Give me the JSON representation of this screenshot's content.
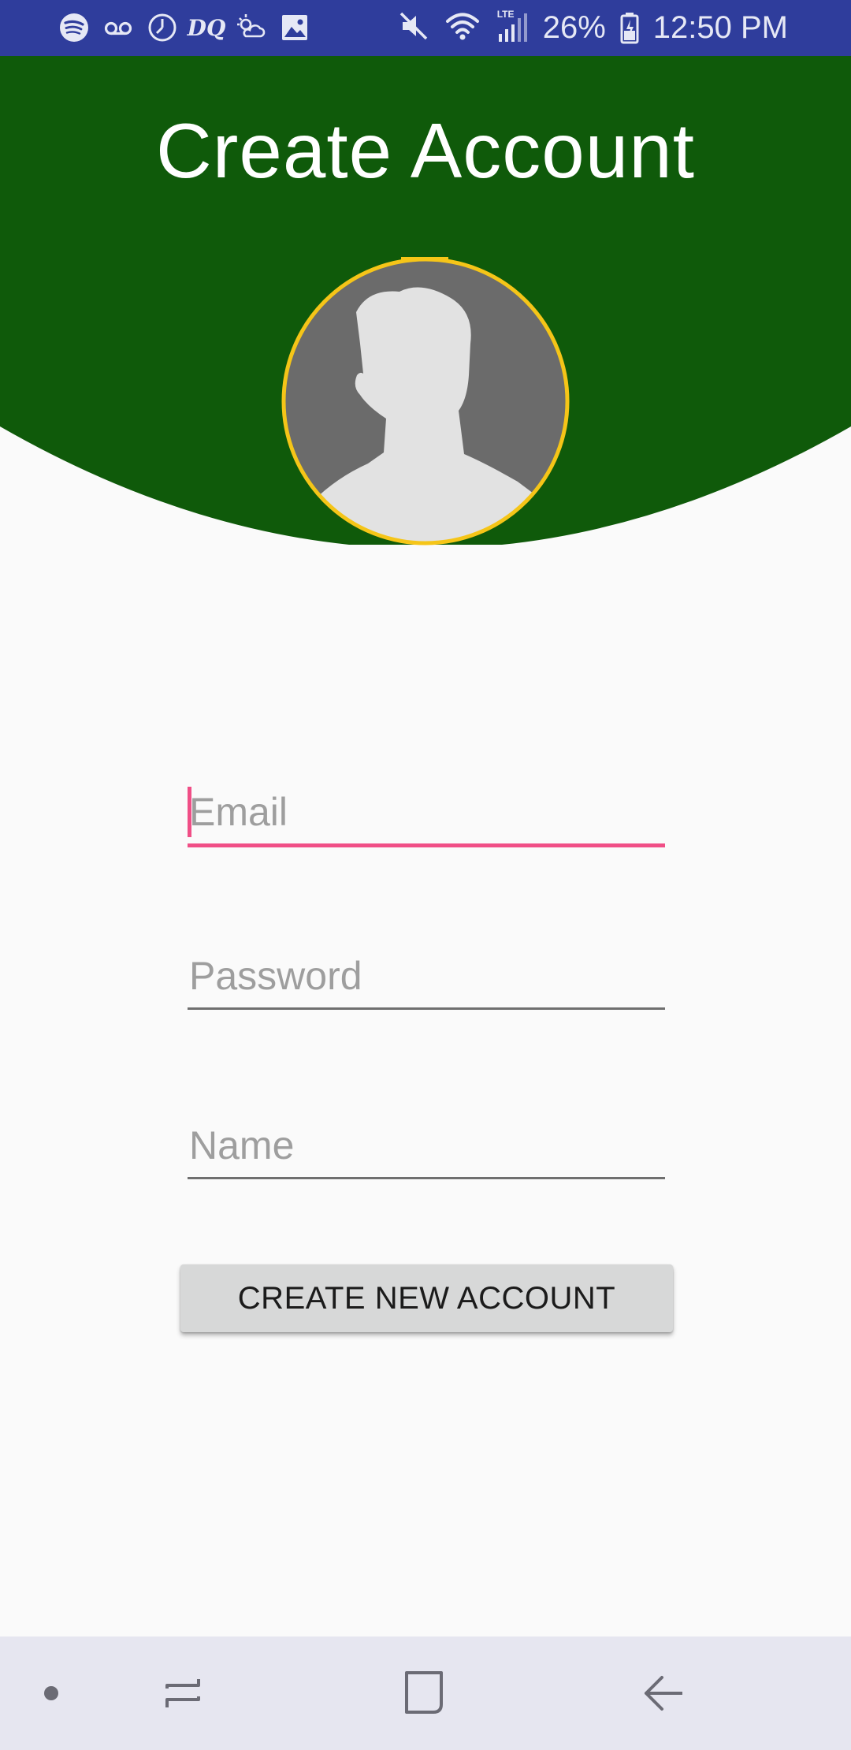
{
  "status_bar": {
    "left_icons": [
      "spotify-icon",
      "voicemail-icon",
      "clock-icon",
      "dq-icon",
      "weather-icon",
      "gallery-icon"
    ],
    "dq_label": "DQ",
    "right_icons": [
      "mute-icon",
      "wifi-icon",
      "signal-icon",
      "battery-icon"
    ],
    "network_label": "LTE",
    "battery_percent": "26%",
    "time": "12:50 PM",
    "background_color": "#2f3d9c"
  },
  "header": {
    "title": "Create Account",
    "background_color": "#0f5a0a"
  },
  "avatar": {
    "icon": "default-user-avatar",
    "border_color": "#f5c518"
  },
  "form": {
    "email": {
      "placeholder": "Email",
      "value": "",
      "focused": true
    },
    "password": {
      "placeholder": "Password",
      "value": ""
    },
    "name": {
      "placeholder": "Name",
      "value": ""
    },
    "accent_color": "#f04e86",
    "submit_label": "CREATE NEW ACCOUNT"
  },
  "nav_bar": {
    "buttons": [
      "dot-icon",
      "recents-icon",
      "home-icon",
      "back-icon"
    ]
  }
}
